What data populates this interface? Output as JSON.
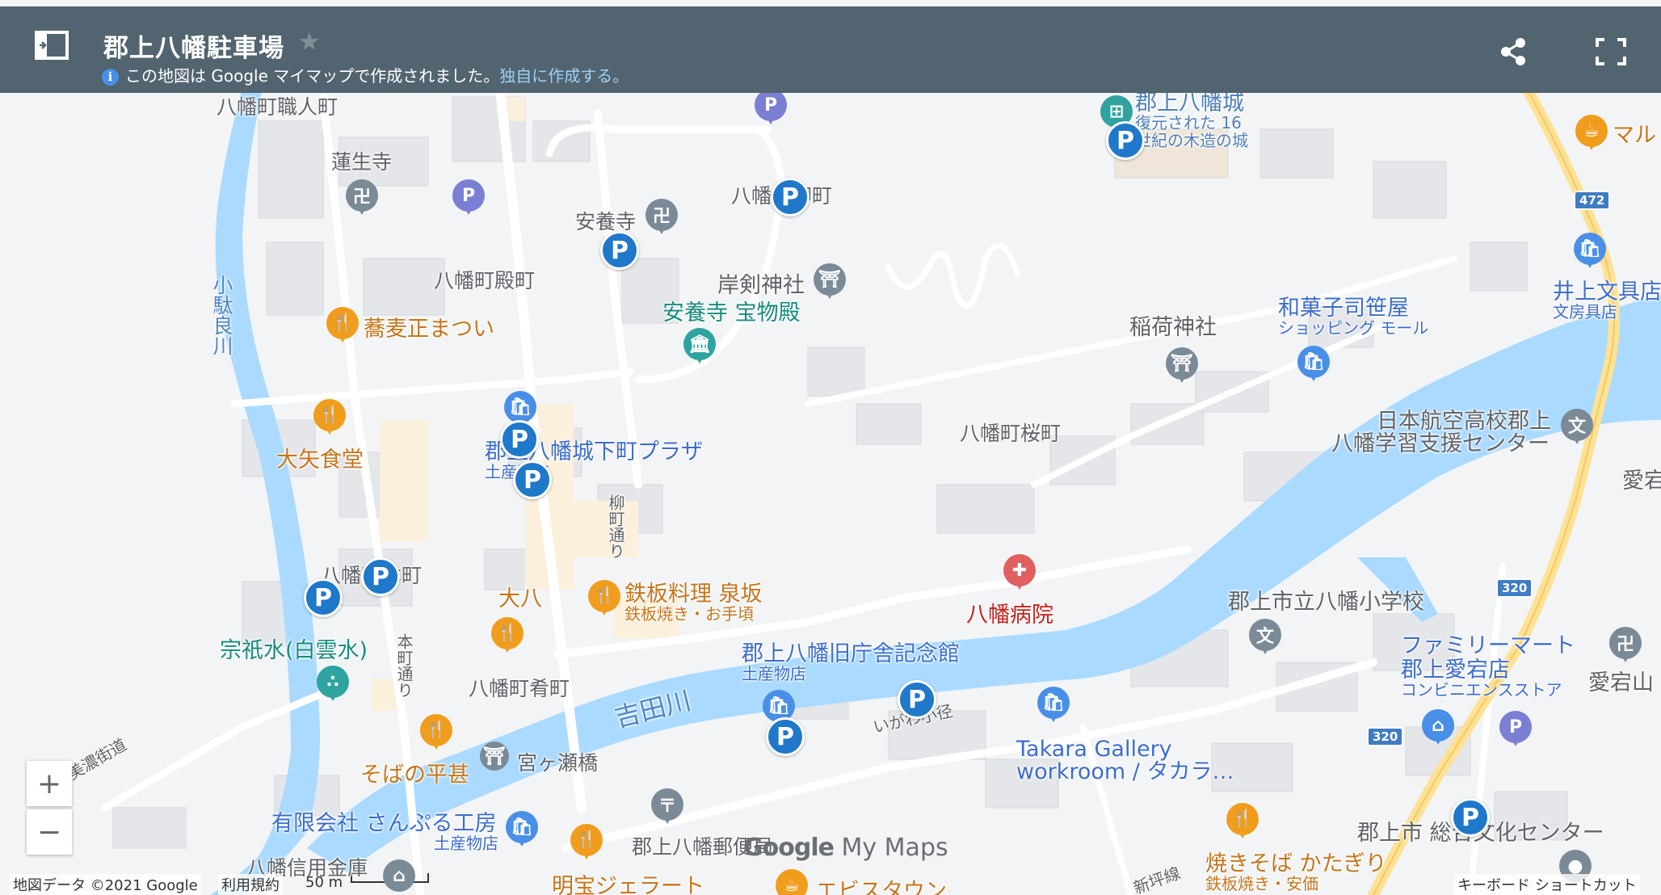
{
  "header": {
    "title": "郡上八幡駐車場",
    "subtitle_prefix": "この地図は Google マイマップで作成されました。",
    "subtitle_link": "独自に作成する。",
    "info_icon": "i"
  },
  "map": {
    "places": {
      "shokunin": "八幡町職人町",
      "rensho": "蓮生寺",
      "anyoji": "安養寺",
      "yanagi": "八幡町柳町",
      "tono": "八幡町殿町",
      "kishitsurugi": "岸剣神社",
      "anyoji_treasure": "安養寺 宝物殿",
      "sobasho": "蕎麦正まつい",
      "kodara": "小駄良川",
      "oya": "大矢食堂",
      "plaza": "郡上八幡城下町プラザ",
      "plaza_sub": "土産物店",
      "honmachi": "八幡町本町",
      "yanagimachi_dori": "柳町通り",
      "daihachi": "大八",
      "senzaka": "鉄板料理 泉坂",
      "senzaka_sub": "鉄板焼き・お手頃",
      "sogisui": "宗祇水(白雲水)",
      "honmachi_dori": "本町通り",
      "sakana": "八幡町肴町",
      "yoshida": "吉田川",
      "kyuchosha": "郡上八幡旧庁舎記念館",
      "kyuchosha_sub": "土産物店",
      "igawa": "いがわ小径",
      "takara1": "Takara Gallery",
      "takara2": "workroom / タカラ…",
      "hirajin": "そばの平甚",
      "miyagase": "宮ヶ瀬橋",
      "sampuru": "有限会社 さんぷる工房",
      "sampuru_sub": "土産物店",
      "mino": "美濃街道",
      "shinyo": "八幡信用金庫",
      "yubin": "郡上八幡郵便局",
      "jelato": "明宝ジェラート",
      "ebisu": "エビスタウン",
      "castle": "郡上八幡城",
      "castle_sub1": "復元された 16",
      "castle_sub2": "世紀の木造の城",
      "maru": "マル",
      "inoue": "井上文具店",
      "inoue_sub": "文房具店",
      "wagashi": "和菓子司笹屋",
      "wagashi_sub": "ショッピング モール",
      "inari": "稲荷神社",
      "sakuramachi": "八幡町桜町",
      "koku1": "日本航空高校郡上",
      "koku2": "八幡学習支援センター",
      "atago": "愛宕",
      "hospital": "八幡病院",
      "shogakko": "郡上市立八幡小学校",
      "family1": "ファミリーマート",
      "family2": "郡上愛宕店",
      "family_sub": "コンビニエンスストア",
      "atagoyama": "愛宕山",
      "bunka": "郡上市 総合文化センター",
      "katagiri": "焼きそば かたぎり",
      "katagiri_sub": "鉄板焼き・安価",
      "shinsaisen": "新坪線"
    },
    "parking_label": "P",
    "route_shields": {
      "r472": "472",
      "r320a": "320",
      "r320b": "320"
    }
  },
  "controls": {
    "zoom_in": "+",
    "zoom_out": "−"
  },
  "footer": {
    "attribution": "地図データ ©2021 Google",
    "terms": "利用規約",
    "scale": "50 m",
    "shortcuts": "キーボード ショートカット",
    "brand_google": "Google",
    "brand_mymaps": "My Maps"
  },
  "colors": {
    "header": "#526470",
    "water": "#aadaff",
    "parking": "#1f78c9",
    "food": "#f09d1e",
    "shopping": "#4a8fe7",
    "poi_gray": "#7b8a97",
    "hospital": "#e06060"
  }
}
